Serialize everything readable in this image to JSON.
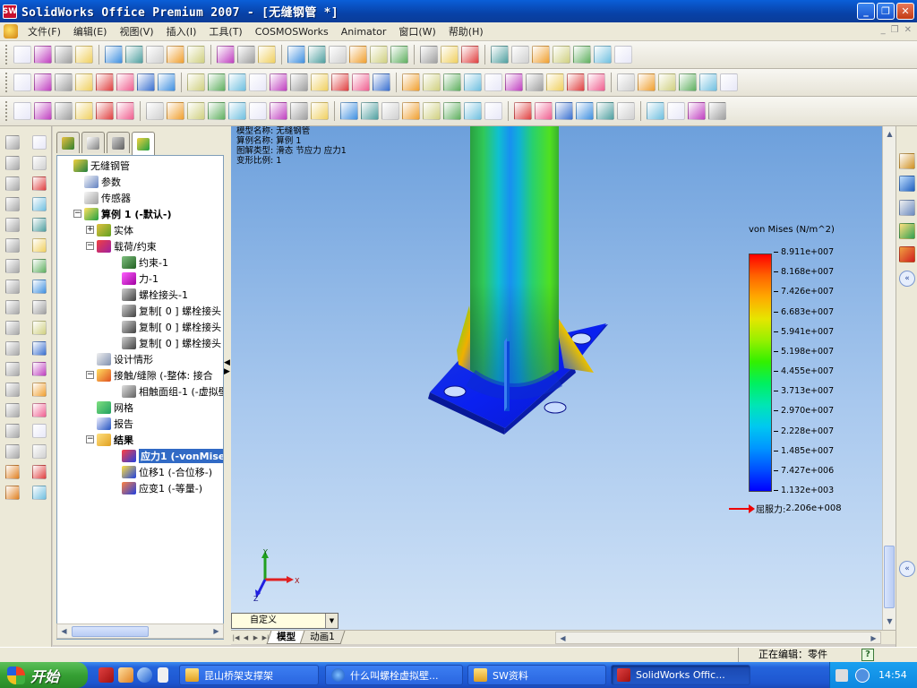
{
  "window": {
    "title": "SolidWorks Office Premium 2007 - [无缝钢管 *]",
    "app_icon_text": "SW",
    "minimize": "_",
    "restore": "❐",
    "close": "✕"
  },
  "menu": {
    "items": [
      "文件(F)",
      "编辑(E)",
      "视图(V)",
      "插入(I)",
      "工具(T)",
      "COSMOSWorks",
      "Animator",
      "窗口(W)",
      "帮助(H)"
    ]
  },
  "feature_manager": {
    "tree": [
      {
        "label": "无缝钢管",
        "icon": "part-icon",
        "level": 0,
        "expander": ""
      },
      {
        "label": "参数",
        "icon": "parameters-icon",
        "level": 1,
        "expander": ""
      },
      {
        "label": "传感器",
        "icon": "sensor-icon",
        "level": 1,
        "expander": ""
      },
      {
        "label": "算例 1 (-默认-)",
        "icon": "study-icon",
        "level": 1,
        "expander": "−",
        "bold": true
      },
      {
        "label": "实体",
        "icon": "solids-icon",
        "level": 2,
        "expander": "+"
      },
      {
        "label": "载荷/约束",
        "icon": "loads-icon",
        "level": 2,
        "expander": "−"
      },
      {
        "label": "约束-1",
        "icon": "fixture-icon",
        "level": 3,
        "expander": ""
      },
      {
        "label": "力-1",
        "icon": "force-icon",
        "level": 3,
        "expander": ""
      },
      {
        "label": "螺栓接头-1",
        "icon": "bolt-icon",
        "level": 3,
        "expander": ""
      },
      {
        "label": "复制[ 0 ] 螺栓接头",
        "icon": "bolt-icon",
        "level": 3,
        "expander": ""
      },
      {
        "label": "复制[ 0 ] 螺栓接头",
        "icon": "bolt-icon",
        "level": 3,
        "expander": ""
      },
      {
        "label": "复制[ 0 ] 螺栓接头",
        "icon": "bolt-icon",
        "level": 3,
        "expander": ""
      },
      {
        "label": "设计情形",
        "icon": "design-scenario-icon",
        "level": 2,
        "expander": ""
      },
      {
        "label": "接触/缝隙 (-整体: 接合",
        "icon": "contact-icon",
        "level": 2,
        "expander": "−"
      },
      {
        "label": "相触面组-1 (-虚拟壁",
        "icon": "contact-set-icon",
        "level": 3,
        "expander": ""
      },
      {
        "label": "网格",
        "icon": "mesh-icon",
        "level": 2,
        "expander": ""
      },
      {
        "label": "报告",
        "icon": "report-icon",
        "level": 2,
        "expander": ""
      },
      {
        "label": "结果",
        "icon": "results-folder-icon",
        "level": 2,
        "expander": "−",
        "bold": true
      },
      {
        "label": "应力1 (-vonMises-",
        "icon": "stress-plot-icon",
        "level": 3,
        "expander": "",
        "selected": true,
        "bold": true
      },
      {
        "label": "位移1 (-合位移-)",
        "icon": "displacement-plot-icon",
        "level": 3,
        "expander": ""
      },
      {
        "label": "应变1 (-等量-)",
        "icon": "strain-plot-icon",
        "level": 3,
        "expander": ""
      }
    ]
  },
  "viewport": {
    "info": [
      "模型名称: 无缝钢管",
      "算例名称: 算例 1",
      "图解类型: 滑态 节应力 应力1",
      "变形比例: 1"
    ],
    "legend": {
      "title": "von Mises (N/m^2)",
      "ticks": [
        "8.911e+007",
        "8.168e+007",
        "7.426e+007",
        "6.683e+007",
        "5.941e+007",
        "5.198e+007",
        "4.455e+007",
        "3.713e+007",
        "2.970e+007",
        "2.228e+007",
        "1.485e+007",
        "7.427e+006",
        "1.132e+003"
      ],
      "yield_label": "屈服力:",
      "yield_value": "2.206e+008"
    },
    "triad": {
      "x": "X",
      "y": "Y",
      "z": "Z"
    }
  },
  "bottom": {
    "combo_value": "自定义",
    "tabs": [
      "模型",
      "动画1"
    ]
  },
  "status": {
    "editing": "正在编辑：零件",
    "help": "?"
  },
  "taskbar": {
    "start_label": "开始",
    "tasks": [
      {
        "label": "昆山桥架支撑架",
        "icon": "folder-icon"
      },
      {
        "label": "什么叫螺栓虚拟壁...",
        "icon": "ie-icon"
      },
      {
        "label": "SW资料",
        "icon": "folder-icon"
      },
      {
        "label": "SolidWorks Offic...",
        "icon": "solidworks-icon"
      }
    ],
    "clock": "14:54"
  }
}
